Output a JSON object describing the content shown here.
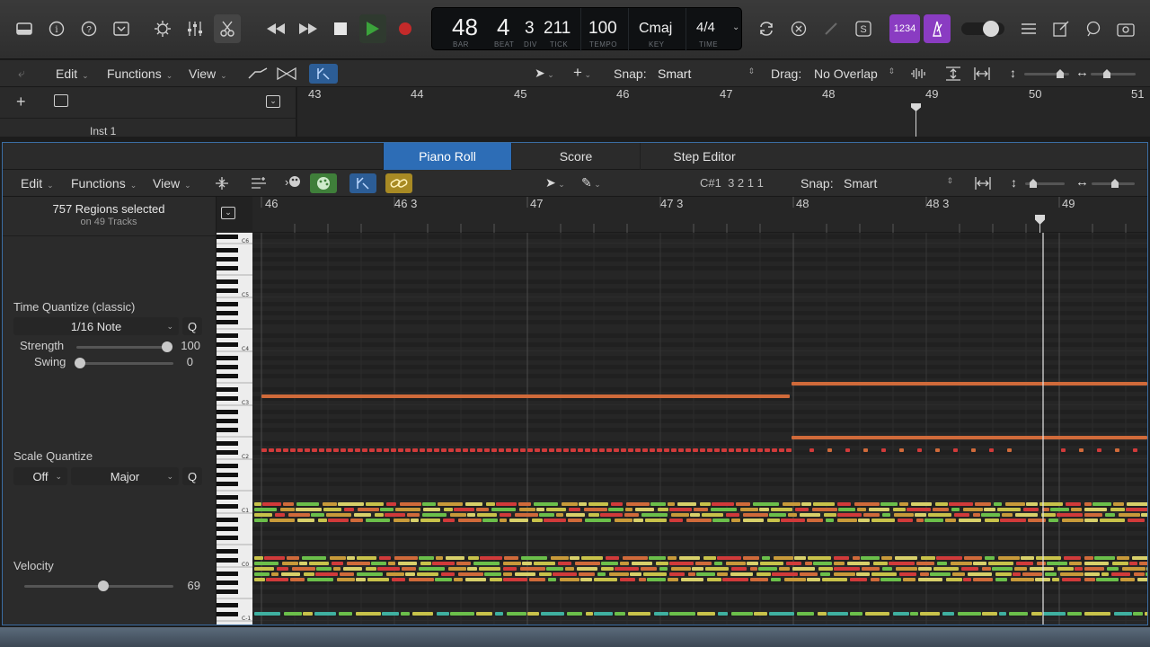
{
  "control_bar": {
    "lcd": {
      "bar": "48",
      "beat": "4",
      "div": "3",
      "tick": "211",
      "tempo": "100",
      "key": "Cmaj",
      "time": "4/4",
      "labels": {
        "bar": "BAR",
        "beat": "BEAT",
        "div": "DIV",
        "tick": "TICK",
        "tempo": "TEMPO",
        "key": "KEY",
        "time": "TIME"
      }
    },
    "count_in_label": "1234"
  },
  "tracks_toolbar": {
    "edit": "Edit",
    "functions": "Functions",
    "view": "View",
    "snap_label": "Snap:",
    "snap_value": "Smart",
    "drag_label": "Drag:",
    "drag_value": "No Overlap"
  },
  "tracks": {
    "track_name": "Inst 1",
    "ruler": [
      "43",
      "44",
      "45",
      "46",
      "47",
      "48",
      "49",
      "50",
      "51"
    ]
  },
  "editor": {
    "tabs": [
      "Piano Roll",
      "Score",
      "Step Editor"
    ],
    "toolbar": {
      "edit": "Edit",
      "functions": "Functions",
      "view": "View",
      "position": "C#1  3 2 1 1",
      "snap_label": "Snap:",
      "snap_value": "Smart"
    },
    "ruler": [
      "46",
      "46 3",
      "47",
      "47 3",
      "48",
      "48 3",
      "49"
    ],
    "inspector": {
      "selection_title": "757 Regions selected",
      "selection_sub": "on 49 Tracks",
      "time_quantize_label": "Time Quantize (classic)",
      "time_quantize_value": "1/16 Note",
      "q_button": "Q",
      "strength_label": "Strength",
      "strength_value": "100",
      "swing_label": "Swing",
      "swing_value": "0",
      "scale_quantize_label": "Scale Quantize",
      "scale_root": "Off",
      "scale_type": "Major",
      "velocity_label": "Velocity",
      "velocity_value": "69"
    },
    "octave_labels": [
      "C6",
      "C5",
      "C4",
      "C3",
      "C2",
      "C1",
      "C0",
      "C-1"
    ]
  },
  "colors": {
    "accent": "#2d6db6",
    "play": "#3ba33b",
    "record": "#c42a2a",
    "note_orange": "#d06a3a",
    "note_red": "#d13a3a",
    "note_yellow": "#c8c24a",
    "note_green": "#6bbf4a"
  }
}
